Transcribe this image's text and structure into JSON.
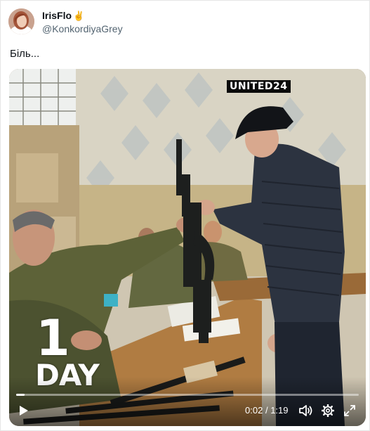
{
  "author": {
    "display_name": "IrisFlo",
    "name_emoji": "✌",
    "handle": "@KonkordiyaGrey"
  },
  "tweet": {
    "text": "Біль..."
  },
  "video": {
    "watermark": "UNITED24",
    "overlay_number": "1",
    "overlay_word": "DAY",
    "current_time": "0:02",
    "separator": "/",
    "duration": "1:19",
    "progress": 0.025
  },
  "icons": {
    "play": "play-icon",
    "volume": "volume-icon",
    "settings": "gear-icon",
    "fullscreen": "fullscreen-icon"
  },
  "colors": {
    "text_primary": "#0f1419",
    "text_secondary": "#536471",
    "controls": "#ffffff"
  }
}
